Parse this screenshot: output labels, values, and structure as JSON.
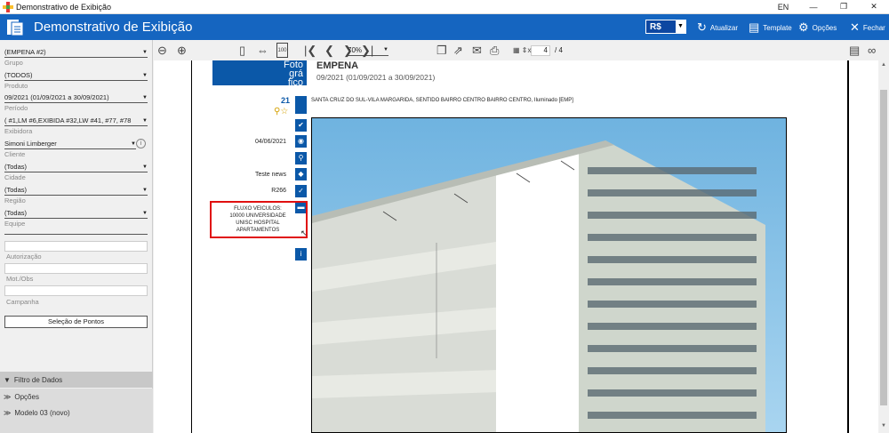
{
  "window": {
    "title": "Demonstrativo de Exibição",
    "lang": "EN"
  },
  "header": {
    "title": "Demonstrativo de Exibição",
    "currency": "R$",
    "refresh": "Atualizar",
    "template": "Template",
    "options": "Opções",
    "close": "Fechar"
  },
  "filters": [
    {
      "value": "(EMPENA #2)",
      "label": "Grupo"
    },
    {
      "value": "(TODOS)",
      "label": "Produto"
    },
    {
      "value": "09/2021 (01/09/2021 a 30/09/2021)",
      "label": "Período"
    },
    {
      "value": "( #1,LM #6,EXIBIDA #32,LW #41, #77, #78",
      "label": "Exibidora"
    },
    {
      "value": "Simoni Limberger",
      "label": "Cliente"
    },
    {
      "value": "(Todas)",
      "label": "Cidade"
    },
    {
      "value": "(Todas)",
      "label": "Região"
    },
    {
      "value": "(Todas)",
      "label": "Equipe"
    }
  ],
  "inputs": {
    "autorizacao": "Autorização",
    "mot_obs": "Mot./Obs",
    "campanha": "Campanha"
  },
  "select_button": "Seleção de Pontos",
  "accordion": [
    "Filtro de Dados",
    "Opções",
    "Modelo 03 (novo)"
  ],
  "toolbar": {
    "zoom": "70%",
    "page": "4",
    "total": "/ 4",
    "fit_label": "100",
    "ratio_label": "x"
  },
  "report": {
    "logo": "Foto\ngrá\nfico",
    "title": "EMPENA",
    "period": "09/2021 (01/09/2021 a 30/09/2021)",
    "number": "21",
    "address": "SANTA CRUZ DO SUL-VILA MARGARIDA, SENTIDO BAIRRO CENTRO BAIRRO CENTRO, Iluminado [EMP]",
    "date": "04/06/2021",
    "campaign": "Teste news",
    "code": "R266",
    "flux": "FLUXO VEICULOS: 10000 UNIVERSIDADE UNISC HOSPITAL APARTAMENTOS"
  },
  "colors": {
    "brand": "#1565c0",
    "accent_dark": "#0b58a8",
    "highlight": "#e01010"
  }
}
